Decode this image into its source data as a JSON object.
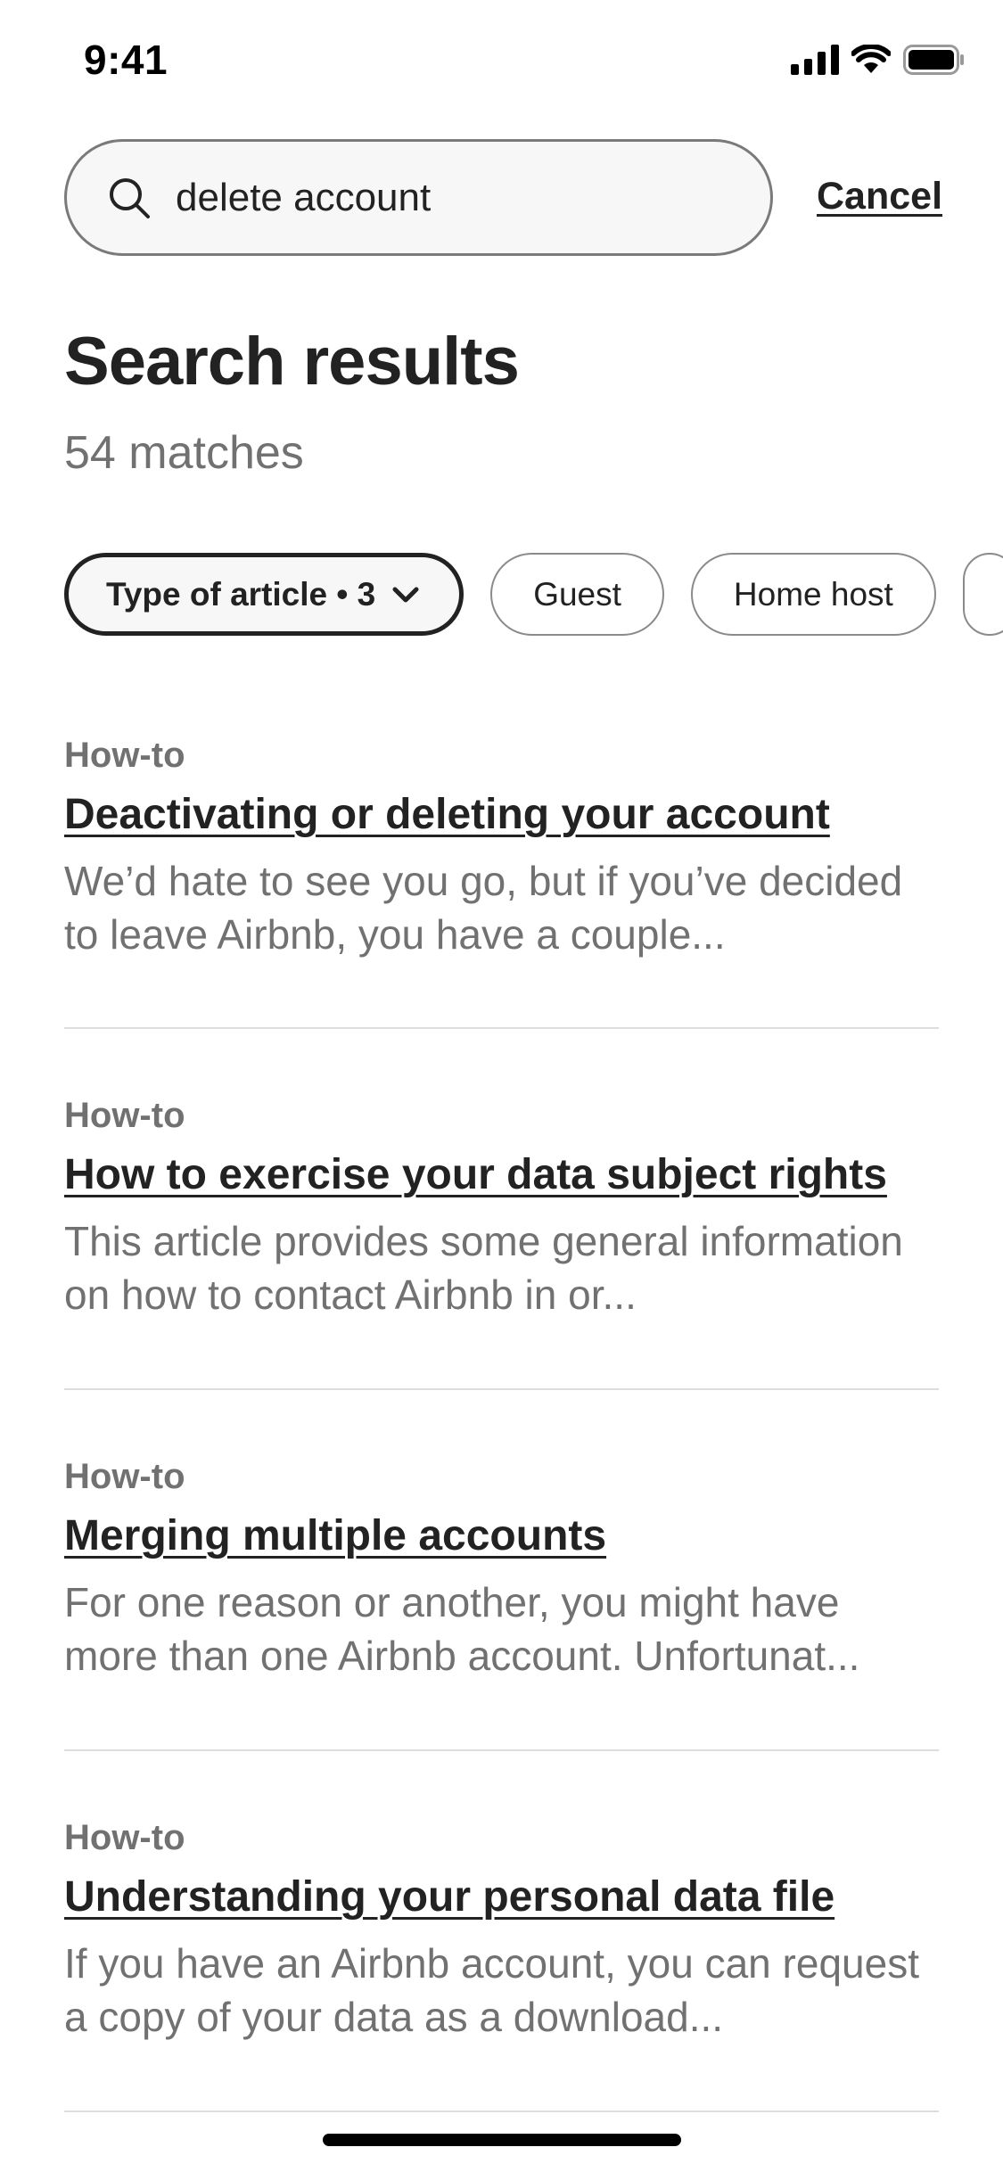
{
  "status_bar": {
    "time": "9:41",
    "icons": [
      "signal-icon",
      "wifi-icon",
      "battery-icon"
    ]
  },
  "search": {
    "query": "delete account",
    "icon": "search-icon",
    "cancel_label": "Cancel"
  },
  "header": {
    "title": "Search results",
    "match_count": "54 matches"
  },
  "filters": {
    "chips": [
      {
        "label": "Type of article • 3",
        "active": true,
        "icon": "chevron-down-icon"
      },
      {
        "label": "Guest",
        "active": false
      },
      {
        "label": "Home host",
        "active": false
      }
    ]
  },
  "results": [
    {
      "type": "How-to",
      "title": "Deactivating or deleting your account",
      "snippet": "We’d hate to see you go, but if you’ve decided to leave Airbnb, you have a couple..."
    },
    {
      "type": "How-to",
      "title": "How to exercise your data subject rights",
      "snippet": "This article provides some general information on how to contact Airbnb in or..."
    },
    {
      "type": "How-to",
      "title": "Merging multiple accounts",
      "snippet": "For one reason or another, you might have more than one Airbnb account. Unfortunat..."
    },
    {
      "type": "How-to",
      "title": "Understanding your personal data file",
      "snippet": "If you have an Airbnb account, you can request a copy of your data as a download..."
    }
  ],
  "colors": {
    "text_primary": "#222222",
    "text_secondary": "#717171",
    "divider": "#dddddd",
    "search_bg": "#f7f7f7"
  }
}
